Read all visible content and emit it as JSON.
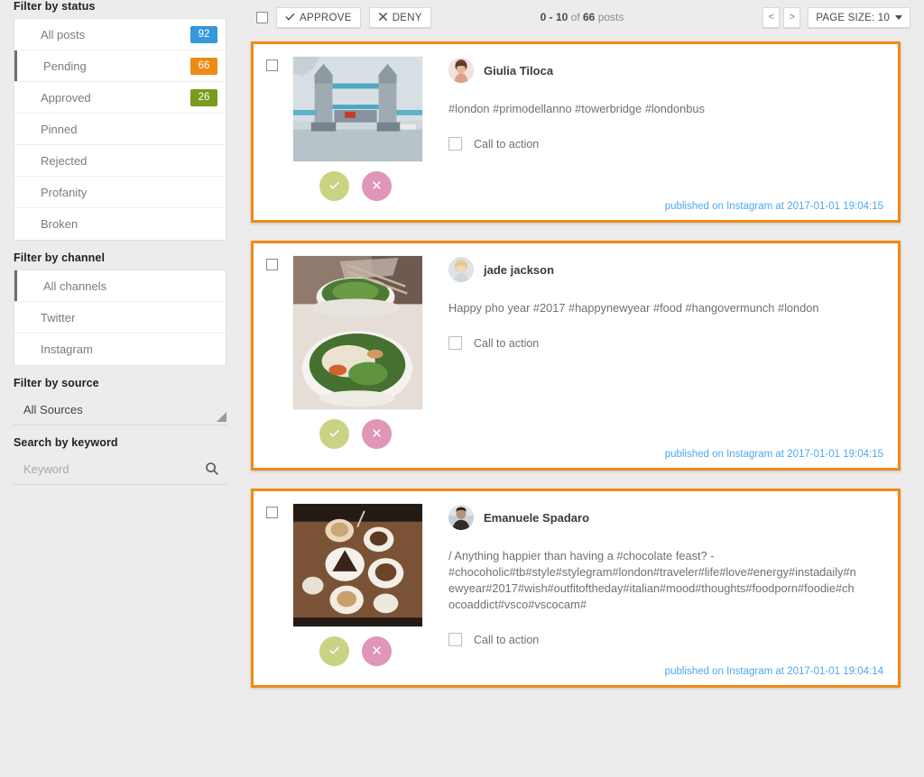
{
  "toolbar": {
    "select_all_checkbox": "",
    "approve_label": "APPROVE",
    "deny_label": "DENY",
    "count_range": "0 - 10",
    "count_of": "of",
    "count_total": "66",
    "count_unit": "posts",
    "prev_label": "<",
    "next_label": ">",
    "page_size_label": "PAGE SIZE: 10"
  },
  "sidebar": {
    "status": {
      "heading": "Filter by status",
      "items": [
        {
          "label": "All posts",
          "badge": "92",
          "badge_color": "#3498db",
          "active": false
        },
        {
          "label": "Pending",
          "badge": "66",
          "badge_color": "#ef8a17",
          "active": true
        },
        {
          "label": "Approved",
          "badge": "26",
          "badge_color": "#7a9a1c",
          "active": false
        },
        {
          "label": "Pinned",
          "badge": "",
          "badge_color": "",
          "active": false
        },
        {
          "label": "Rejected",
          "badge": "",
          "badge_color": "",
          "active": false
        },
        {
          "label": "Profanity",
          "badge": "",
          "badge_color": "",
          "active": false
        },
        {
          "label": "Broken",
          "badge": "",
          "badge_color": "",
          "active": false
        }
      ]
    },
    "channel": {
      "heading": "Filter by channel",
      "items": [
        {
          "label": "All channels",
          "active": true
        },
        {
          "label": "Twitter",
          "active": false
        },
        {
          "label": "Instagram",
          "active": false
        }
      ]
    },
    "source": {
      "heading": "Filter by source",
      "selected": "All Sources"
    },
    "keyword": {
      "heading": "Search by keyword",
      "value": "",
      "placeholder": "Keyword"
    }
  },
  "posts": [
    {
      "author": "Giulia Tiloca",
      "text": "#london #primodellanno #towerbridge #londonbus",
      "cta_label": "Call to action",
      "footer": "published on Instagram at 2017-01-01 19:04:15",
      "approve_icon": "check-icon",
      "deny_icon": "cross-icon"
    },
    {
      "author": "jade jackson",
      "text": "Happy pho year #2017 #happynewyear #food #hangovermunch #london",
      "cta_label": "Call to action",
      "footer": "published on Instagram at 2017-01-01 19:04:15",
      "approve_icon": "check-icon",
      "deny_icon": "cross-icon"
    },
    {
      "author": "Emanuele Spadaro",
      "text": "/ Anything happier than having a #chocolate feast? - #chocoholic#tb#style#stylegram#london#traveler#life#love#energy#instadaily#newyear#2017#wish#outfitoftheday#italian#mood#thoughts#foodporn#foodie#chocoaddict#vsco#vscocam#",
      "cta_label": "Call to action",
      "footer": "published on Instagram at 2017-01-01 19:04:14",
      "approve_icon": "check-icon",
      "deny_icon": "cross-icon"
    }
  ],
  "colors": {
    "accent_orange": "#ef8a17",
    "link_blue": "#4fa8ef",
    "approve_green": "#c9d383",
    "deny_pink": "#e096b6",
    "page_bg": "#ececec"
  }
}
